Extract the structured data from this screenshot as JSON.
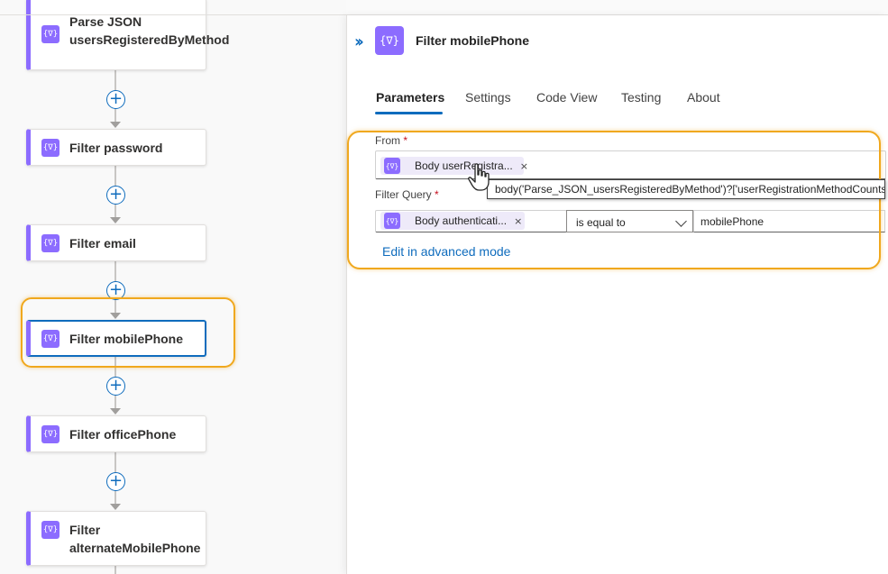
{
  "canvas": {
    "nodes": [
      {
        "label": "Parse JSON\nusersRegisteredByMethod"
      },
      {
        "label": "Filter password"
      },
      {
        "label": "Filter email"
      },
      {
        "label": "Filter mobilePhone"
      },
      {
        "label": "Filter officePhone"
      },
      {
        "label": "Filter\nalternateMobilePhone"
      }
    ],
    "add_symbol": "+",
    "action_icon": "{∇}"
  },
  "panel": {
    "title": "Filter mobilePhone",
    "collapse_icon": "double-chevron-right-icon",
    "tabs": [
      "Parameters",
      "Settings",
      "Code View",
      "Testing",
      "About"
    ],
    "active_tab": "Parameters",
    "from": {
      "label": "From",
      "required": "*",
      "token": "Body userRegistra...",
      "tooltip": "body('Parse_JSON_usersRegisteredByMethod')?['userRegistrationMethodCounts']"
    },
    "filter_query": {
      "label": "Filter Query",
      "required": "*",
      "token": "Body authenticati...",
      "operator": "is equal to",
      "value": "mobilePhone"
    },
    "advanced_link": "Edit in advanced mode",
    "remove_symbol": "×"
  },
  "colors": {
    "action_purple": "#8c6cff",
    "accent_blue": "#0f6cbd",
    "highlight_orange": "#f0a81e"
  }
}
